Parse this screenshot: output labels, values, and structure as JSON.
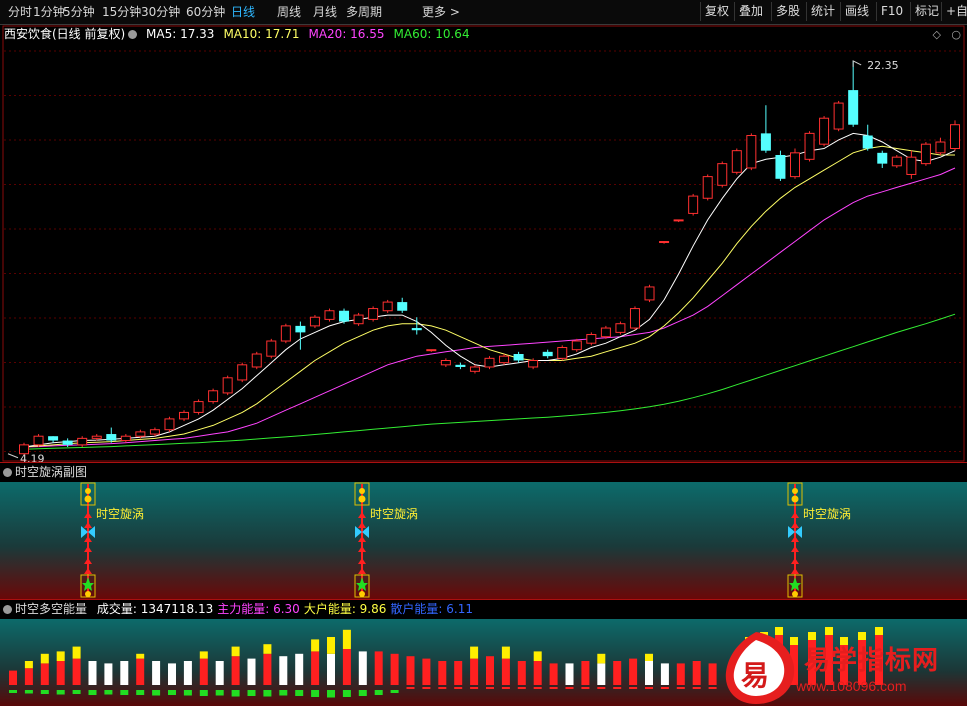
{
  "toolbar": {
    "periods": [
      "分时",
      "1分钟",
      "5分钟",
      "15分钟",
      "30分钟",
      "60分钟",
      "日线",
      "周线",
      "月线",
      "多周期",
      "更多"
    ],
    "active_period": "日线",
    "right_buttons": [
      "复权",
      "叠加",
      "多股",
      "统计",
      "画线",
      "F10",
      "标记",
      "+自"
    ]
  },
  "main_chart": {
    "title": "西安饮食(日线 前复权)",
    "ma_labels": [
      {
        "text": "MA5: 17.33",
        "color": "#ffffff"
      },
      {
        "text": "MA10: 17.71",
        "color": "#ffff66"
      },
      {
        "text": "MA20: 16.55",
        "color": "#ff44ff"
      },
      {
        "text": "MA60: 10.64",
        "color": "#33ee33"
      }
    ],
    "high_label": "22.35",
    "low_label": "4.19"
  },
  "indicator1": {
    "title": "时空旋涡副图",
    "signal_text": "时空旋涡"
  },
  "indicator2": {
    "title": "时空多空能量",
    "values": [
      {
        "label": "成交量: 1347118.13",
        "color": "#ffffff"
      },
      {
        "label": "主力能量: 6.30",
        "color": "#ff44ff"
      },
      {
        "label": "大户能量: 9.86",
        "color": "#ffff44"
      },
      {
        "label": "散户能量: 6.11",
        "color": "#3366ff"
      }
    ]
  },
  "watermark": {
    "logo_char": "易",
    "name": "易学指标网",
    "url": "www.108096.com"
  },
  "colors": {
    "up": "#ff3030",
    "down": "#55ffff",
    "ma5": "#ffffff",
    "ma10": "#ffff66",
    "ma20": "#ff44ff",
    "ma60": "#33ee33"
  },
  "chart_data": {
    "type": "candlestick",
    "price_range": [
      4.19,
      22.35
    ],
    "candles": [
      [
        4.19,
        4.6,
        4.1,
        4.7
      ],
      [
        4.6,
        5.0,
        4.5,
        5.1
      ],
      [
        5.0,
        4.8,
        4.7,
        5.0
      ],
      [
        4.8,
        4.6,
        4.5,
        4.9
      ],
      [
        4.6,
        4.9,
        4.5,
        5.0
      ],
      [
        4.9,
        5.0,
        4.8,
        5.1
      ],
      [
        5.1,
        4.8,
        4.7,
        5.4
      ],
      [
        4.8,
        5.0,
        4.7,
        5.1
      ],
      [
        5.0,
        5.2,
        4.9,
        5.3
      ],
      [
        5.1,
        5.3,
        5.0,
        5.4
      ],
      [
        5.3,
        5.8,
        5.2,
        5.9
      ],
      [
        5.8,
        6.1,
        5.7,
        6.2
      ],
      [
        6.1,
        6.6,
        6.0,
        6.7
      ],
      [
        6.6,
        7.1,
        6.5,
        7.2
      ],
      [
        7.0,
        7.7,
        6.9,
        7.8
      ],
      [
        7.6,
        8.3,
        7.5,
        8.4
      ],
      [
        8.2,
        8.8,
        8.1,
        8.9
      ],
      [
        8.7,
        9.4,
        8.6,
        9.5
      ],
      [
        9.4,
        10.1,
        9.3,
        10.2
      ],
      [
        10.1,
        9.8,
        9.0,
        10.3
      ],
      [
        10.1,
        10.5,
        10.0,
        10.6
      ],
      [
        10.4,
        10.8,
        10.3,
        10.9
      ],
      [
        10.8,
        10.3,
        10.2,
        10.9
      ],
      [
        10.2,
        10.6,
        10.1,
        10.7
      ],
      [
        10.4,
        10.9,
        10.3,
        11.0
      ],
      [
        10.8,
        11.2,
        10.7,
        11.3
      ],
      [
        11.2,
        10.8,
        10.7,
        11.4
      ],
      [
        10.0,
        9.9,
        9.7,
        10.5
      ],
      [
        9.0,
        9.0,
        8.9,
        9.0
      ],
      [
        8.3,
        8.5,
        8.2,
        8.6
      ],
      [
        8.3,
        8.2,
        8.1,
        8.4
      ],
      [
        8.0,
        8.2,
        7.9,
        8.3
      ],
      [
        8.2,
        8.6,
        8.1,
        8.7
      ],
      [
        8.4,
        8.7,
        8.3,
        8.8
      ],
      [
        8.8,
        8.5,
        8.4,
        8.9
      ],
      [
        8.2,
        8.5,
        8.1,
        8.6
      ],
      [
        8.9,
        8.7,
        8.6,
        9.0
      ],
      [
        8.6,
        9.1,
        8.5,
        9.2
      ],
      [
        9.0,
        9.4,
        8.9,
        9.5
      ],
      [
        9.3,
        9.7,
        9.2,
        9.8
      ],
      [
        9.6,
        10.0,
        9.5,
        10.1
      ],
      [
        9.8,
        10.2,
        9.7,
        10.3
      ],
      [
        10.0,
        10.9,
        9.9,
        11.0
      ],
      [
        11.3,
        11.9,
        11.2,
        12.0
      ],
      [
        14.0,
        14.0,
        13.9,
        14.0
      ],
      [
        15.0,
        15.0,
        14.9,
        15.0
      ],
      [
        15.3,
        16.1,
        15.2,
        16.2
      ],
      [
        16.0,
        17.0,
        15.9,
        17.1
      ],
      [
        16.6,
        17.6,
        16.5,
        17.7
      ],
      [
        17.2,
        18.2,
        17.1,
        18.3
      ],
      [
        17.4,
        18.9,
        17.3,
        19.0
      ],
      [
        19.0,
        18.2,
        18.1,
        20.3
      ],
      [
        18.0,
        16.9,
        16.8,
        18.2
      ],
      [
        17.0,
        18.1,
        16.9,
        18.3
      ],
      [
        17.8,
        19.0,
        17.7,
        19.1
      ],
      [
        18.5,
        19.7,
        18.4,
        19.8
      ],
      [
        19.2,
        20.4,
        19.1,
        20.5
      ],
      [
        21.0,
        19.4,
        19.3,
        22.35
      ],
      [
        18.9,
        18.3,
        18.2,
        19.4
      ],
      [
        18.1,
        17.6,
        17.4,
        18.2
      ],
      [
        17.5,
        17.9,
        17.4,
        18.0
      ],
      [
        17.1,
        17.9,
        16.9,
        18.2
      ],
      [
        17.6,
        18.5,
        17.5,
        18.6
      ],
      [
        18.1,
        18.6,
        18.0,
        18.8
      ],
      [
        18.3,
        19.4,
        18.2,
        19.6
      ]
    ],
    "ma5": [
      4.5,
      4.6,
      4.7,
      4.75,
      4.8,
      4.82,
      4.86,
      4.9,
      4.95,
      5.0,
      5.2,
      5.5,
      5.8,
      6.2,
      6.7,
      7.2,
      7.8,
      8.4,
      9.0,
      9.5,
      9.8,
      10.1,
      10.3,
      10.4,
      10.5,
      10.6,
      10.6,
      10.3,
      9.8,
      9.2,
      8.7,
      8.3,
      8.2,
      8.3,
      8.4,
      8.5,
      8.5,
      8.6,
      8.8,
      9.1,
      9.3,
      9.6,
      9.9,
      10.4,
      11.3,
      12.5,
      13.8,
      15.0,
      16.0,
      16.9,
      17.6,
      17.8,
      17.9,
      18.0,
      18.2,
      18.3,
      18.7,
      19.0,
      18.9,
      18.6,
      18.2,
      17.8,
      17.7,
      17.9,
      18.2
    ],
    "ma10": [
      4.5,
      4.55,
      4.6,
      4.65,
      4.7,
      4.72,
      4.75,
      4.8,
      4.85,
      4.9,
      5.0,
      5.1,
      5.3,
      5.5,
      5.8,
      6.1,
      6.5,
      7.0,
      7.5,
      8.0,
      8.5,
      8.9,
      9.3,
      9.6,
      9.9,
      10.1,
      10.2,
      10.2,
      10.1,
      9.9,
      9.6,
      9.3,
      9.0,
      8.8,
      8.6,
      8.5,
      8.5,
      8.5,
      8.6,
      8.7,
      8.9,
      9.1,
      9.3,
      9.6,
      10.1,
      10.7,
      11.4,
      12.2,
      13.0,
      13.9,
      14.7,
      15.4,
      16.0,
      16.5,
      16.9,
      17.3,
      17.7,
      18.1,
      18.3,
      18.4,
      18.3,
      18.2,
      18.1,
      18.0,
      18.0
    ],
    "ma20": [
      4.5,
      4.52,
      4.55,
      4.58,
      4.6,
      4.63,
      4.66,
      4.7,
      4.75,
      4.8,
      4.85,
      4.9,
      5.0,
      5.1,
      5.2,
      5.4,
      5.6,
      5.9,
      6.2,
      6.5,
      6.8,
      7.1,
      7.4,
      7.7,
      8.0,
      8.3,
      8.5,
      8.7,
      8.8,
      8.9,
      9.0,
      9.1,
      9.15,
      9.2,
      9.25,
      9.3,
      9.35,
      9.4,
      9.45,
      9.5,
      9.55,
      9.6,
      9.7,
      9.8,
      10.0,
      10.3,
      10.6,
      11.0,
      11.5,
      12.0,
      12.5,
      13.0,
      13.5,
      14.0,
      14.5,
      15.0,
      15.4,
      15.8,
      16.1,
      16.3,
      16.5,
      16.7,
      16.9,
      17.1,
      17.4
    ],
    "ma60": [
      4.4,
      4.42,
      4.44,
      4.46,
      4.48,
      4.5,
      4.52,
      4.55,
      4.58,
      4.61,
      4.64,
      4.67,
      4.7,
      4.74,
      4.78,
      4.82,
      4.87,
      4.92,
      4.97,
      5.02,
      5.08,
      5.14,
      5.2,
      5.26,
      5.32,
      5.38,
      5.44,
      5.5,
      5.56,
      5.6,
      5.64,
      5.68,
      5.72,
      5.76,
      5.8,
      5.84,
      5.88,
      5.93,
      5.98,
      6.04,
      6.1,
      6.18,
      6.26,
      6.36,
      6.48,
      6.62,
      6.78,
      6.96,
      7.16,
      7.38,
      7.6,
      7.82,
      8.04,
      8.26,
      8.48,
      8.7,
      8.92,
      9.14,
      9.36,
      9.58,
      9.8,
      10.0,
      10.2,
      10.42,
      10.64
    ],
    "vortex_signals": [
      5,
      22,
      49
    ],
    "energy": {
      "bar_colors": [
        "r",
        "r",
        "r",
        "r",
        "r",
        "w",
        "w",
        "w",
        "r",
        "w",
        "w",
        "w",
        "r",
        "w",
        "r",
        "w",
        "r",
        "w",
        "w",
        "r",
        "w",
        "r",
        "w",
        "r",
        "r",
        "r",
        "r",
        "r",
        "r",
        "r",
        "r",
        "r",
        "r",
        "r",
        "r",
        "w",
        "r",
        "w",
        "r",
        "r",
        "w",
        "w",
        "r",
        "r",
        "r",
        "r",
        "r",
        "r",
        "r",
        "r",
        "r",
        "r",
        "r",
        "r",
        "r"
      ],
      "bar_values": [
        0.3,
        0.35,
        0.45,
        0.5,
        0.55,
        0.5,
        0.45,
        0.5,
        0.55,
        0.5,
        0.45,
        0.5,
        0.55,
        0.5,
        0.6,
        0.55,
        0.65,
        0.6,
        0.65,
        0.7,
        0.65,
        0.75,
        0.7,
        0.7,
        0.65,
        0.6,
        0.55,
        0.5,
        0.5,
        0.55,
        0.6,
        0.55,
        0.5,
        0.5,
        0.45,
        0.45,
        0.5,
        0.45,
        0.5,
        0.55,
        0.5,
        0.45,
        0.45,
        0.5,
        0.45,
        0.5,
        0.55,
        0.55,
        0.6,
        0.6,
        0.65,
        0.6,
        0.6,
        0.55,
        0.6
      ],
      "yellow_caps": [
        0.0,
        0.15,
        0.2,
        0.2,
        0.25,
        0.0,
        0.0,
        0.0,
        0.1,
        0.0,
        0.0,
        0.0,
        0.15,
        0.0,
        0.2,
        0.0,
        0.2,
        0.0,
        0.0,
        0.25,
        0.35,
        0.4,
        0.0,
        0.0,
        0.0,
        0.0,
        0.0,
        0.0,
        0.0,
        0.25,
        0.0,
        0.25,
        0.0,
        0.2,
        0.0,
        0.0,
        0.0,
        0.2,
        0.0,
        0.0,
        0.15,
        0.0,
        0.0,
        0.0,
        0.0,
        0.0,
        0.0,
        0.2,
        0.15,
        0.2,
        0.0,
        0.15,
        0.15,
        0.1,
        0.0
      ],
      "green_below": [
        0.3,
        0.35,
        0.4,
        0.45,
        0.4,
        0.5,
        0.45,
        0.5,
        0.5,
        0.55,
        0.5,
        0.55,
        0.6,
        0.55,
        0.65,
        0.6,
        0.65,
        0.55,
        0.6,
        0.7,
        0.75,
        0.7,
        0.6,
        0.5,
        0.3,
        0.0,
        0.0,
        0.0,
        0.0,
        0.0,
        0.0,
        0.0,
        0.0,
        0.0,
        0.0,
        0.0,
        0.0,
        0.0,
        0.0,
        0.0,
        0.0,
        0.0,
        0.0,
        0.0,
        0.0,
        0.0,
        0.0,
        0.0,
        0.0,
        0.0,
        0.0,
        0.0,
        0.0,
        0.0,
        0.0
      ]
    }
  }
}
